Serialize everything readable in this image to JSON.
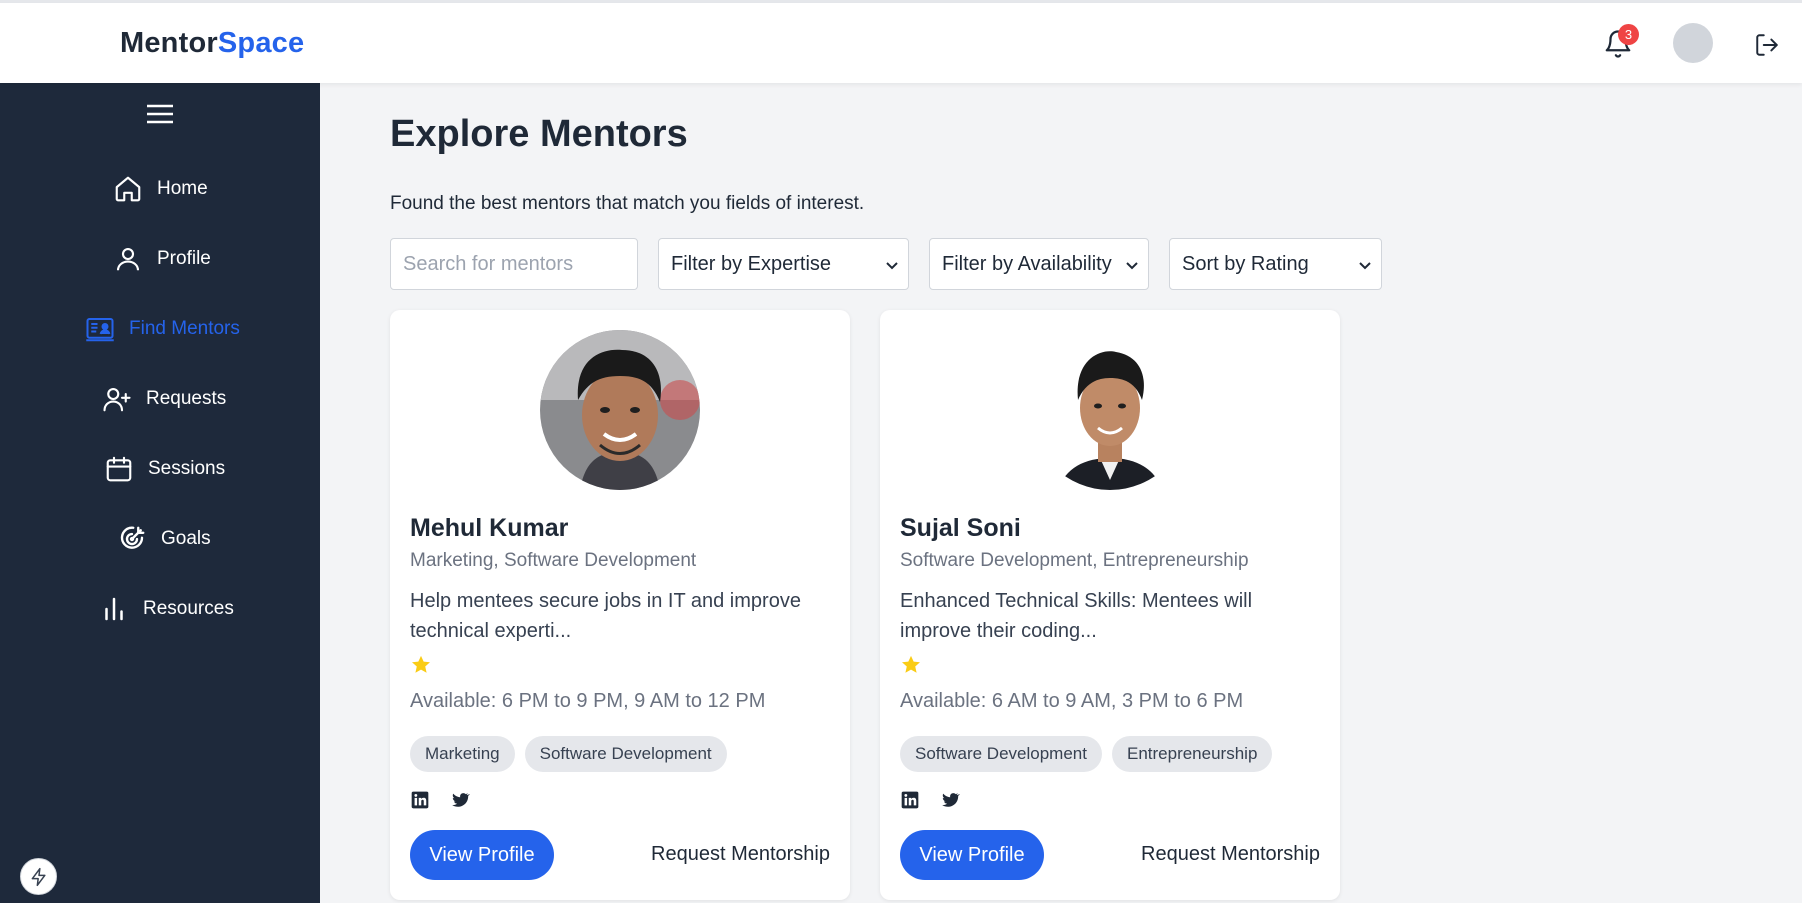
{
  "header": {
    "logo_part1": "Mentor",
    "logo_part2": "Space",
    "notification_count": "3",
    "icons": [
      "bell-icon",
      "avatar",
      "logout-icon"
    ]
  },
  "sidebar": {
    "items": [
      {
        "label": "Home",
        "icon": "home-icon"
      },
      {
        "label": "Profile",
        "icon": "user-icon"
      },
      {
        "label": "Find Mentors",
        "icon": "id-card-icon",
        "active": true
      },
      {
        "label": "Requests",
        "icon": "user-plus-icon"
      },
      {
        "label": "Sessions",
        "icon": "calendar-icon"
      },
      {
        "label": "Goals",
        "icon": "target-icon"
      },
      {
        "label": "Resources",
        "icon": "bar-chart-icon"
      }
    ]
  },
  "main": {
    "title": "Explore Mentors",
    "subtitle": "Found the best mentors that match you fields of interest.",
    "search_placeholder": "Search for mentors",
    "filter_expertise": "Filter by Expertise",
    "filter_availability": "Filter by Availability",
    "sort": "Sort by Rating"
  },
  "mentors": [
    {
      "name": "Mehul Kumar",
      "expertise": "Marketing, Software Development",
      "description": "Help mentees secure jobs in IT and improve technical experti...",
      "available": "Available: 6 PM to 9 PM, 9 AM to 12 PM",
      "tags": [
        "Marketing",
        "Software Development"
      ],
      "rating_stars": 1,
      "view_label": "View Profile",
      "request_label": "Request Mentorship"
    },
    {
      "name": "Sujal Soni",
      "expertise": "Software Development, Entrepreneurship",
      "description": "Enhanced Technical Skills: Mentees will improve their coding...",
      "available": "Available: 6 AM to 9 AM, 3 PM to 6 PM",
      "tags": [
        "Software Development",
        "Entrepreneurship"
      ],
      "rating_stars": 1,
      "view_label": "View Profile",
      "request_label": "Request Mentorship"
    }
  ],
  "colors": {
    "brand": "#2563eb",
    "sidebar_bg": "#1e293b",
    "star": "#facc15",
    "badge": "#ef4444"
  }
}
